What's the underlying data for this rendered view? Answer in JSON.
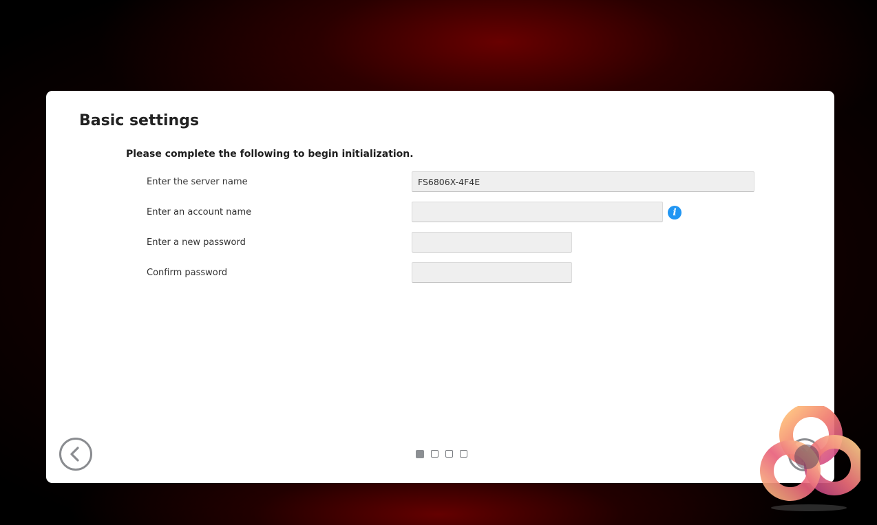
{
  "page": {
    "title": "Basic settings",
    "intro": "Please complete the following to begin initialization."
  },
  "form": {
    "server_name": {
      "label": "Enter the server name",
      "value": "FS6806X-4F4E",
      "placeholder": ""
    },
    "account_name": {
      "label": "Enter an account name",
      "value": "",
      "placeholder": ""
    },
    "new_password": {
      "label": "Enter a new password",
      "value": "",
      "placeholder": ""
    },
    "confirm_password": {
      "label": "Confirm password",
      "value": "",
      "placeholder": ""
    },
    "info_icon_glyph": "i"
  },
  "navigation": {
    "back_icon": "chevron-left-icon",
    "next_icon": "chevron-right-icon",
    "steps_total": 4,
    "current_step": 1
  },
  "colors": {
    "info_blue": "#2196f3",
    "nav_gray": "#8a8c90",
    "panel_bg": "#ffffff",
    "input_bg": "#efefef"
  }
}
